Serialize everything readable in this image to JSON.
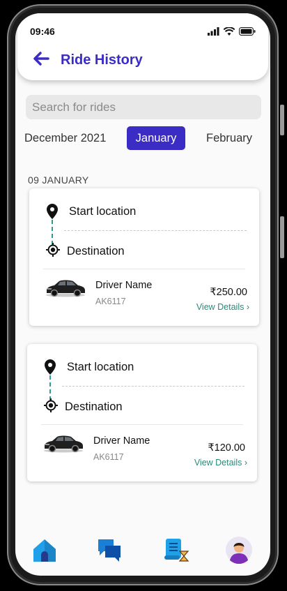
{
  "status_bar": {
    "time": "09:46"
  },
  "header": {
    "title": "Ride History"
  },
  "search": {
    "placeholder": "Search for rides"
  },
  "months": {
    "prev": "December 2021",
    "current": "January",
    "next": "February"
  },
  "section": {
    "date": "09 JANUARY"
  },
  "rides": [
    {
      "start": "Start location",
      "destination": "Destination",
      "driver": "Driver Name",
      "vehicle_no": "AK6117",
      "price": "₹250.00",
      "details_link": "View Details  ›"
    },
    {
      "start": "Start location",
      "destination": "Destination",
      "driver": "Driver Name",
      "vehicle_no": "AK6117",
      "price": "₹120.00",
      "details_link": "View Details  ›"
    }
  ],
  "nav": {
    "icons": [
      "home-icon",
      "chat-icon",
      "history-icon",
      "profile-icon"
    ]
  },
  "colors": {
    "accent": "#3a2cc4",
    "teal": "#2a8a7a",
    "home_blue": "#1fa0e8"
  }
}
